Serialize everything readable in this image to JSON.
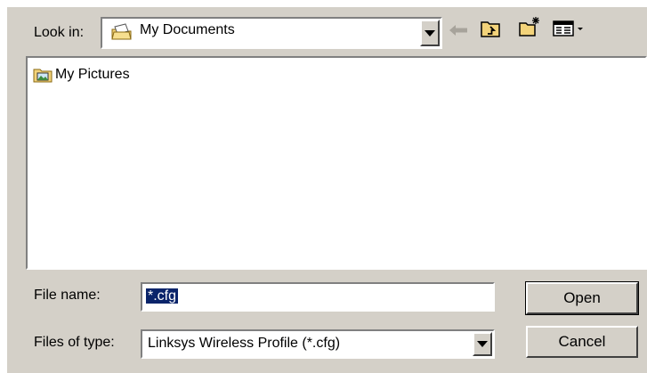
{
  "look_in": {
    "label": "Look in:",
    "value": "My Documents",
    "icon": "my-documents-folder-icon"
  },
  "toolbar": {
    "back_icon": "back-arrow-icon",
    "up_icon": "up-one-level-icon",
    "new_folder_icon": "new-folder-icon",
    "views_icon": "view-menu-icon"
  },
  "file_list": {
    "items": [
      {
        "label": "My Pictures",
        "icon": "my-pictures-folder-icon"
      }
    ]
  },
  "file_name": {
    "label": "File name:",
    "value": "*.cfg"
  },
  "files_of_type": {
    "label": "Files of type:",
    "value": "Linksys Wireless Profile (*.cfg)"
  },
  "buttons": {
    "open_label": "Open",
    "cancel_label": "Cancel"
  }
}
